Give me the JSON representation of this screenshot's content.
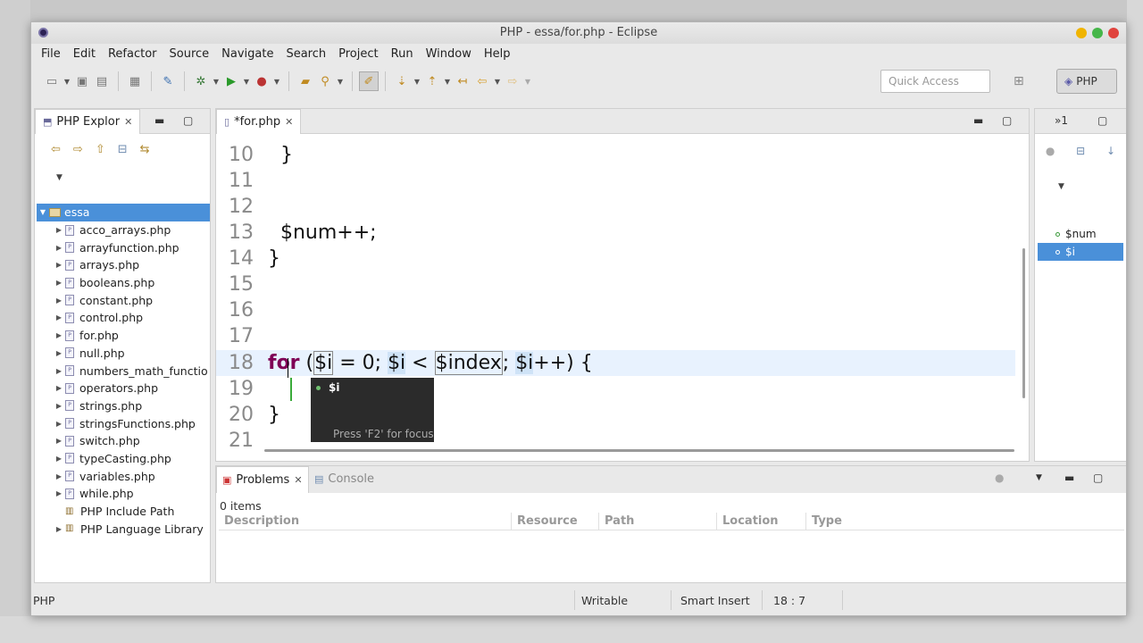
{
  "window": {
    "title": "PHP - essa/for.php - Eclipse"
  },
  "menu": [
    "File",
    "Edit",
    "Refactor",
    "Source",
    "Navigate",
    "Search",
    "Project",
    "Run",
    "Window",
    "Help"
  ],
  "toolbar": {
    "quick_access_placeholder": "Quick Access",
    "perspective_label": "PHP"
  },
  "explorer": {
    "tab_label": "PHP Explor",
    "project": "essa",
    "files": [
      "acco_arrays.php",
      "arrayfunction.php",
      "arrays.php",
      "booleans.php",
      "constant.php",
      "control.php",
      "for.php",
      "null.php",
      "numbers_math_functio",
      "operators.php",
      "strings.php",
      "stringsFunctions.php",
      "switch.php",
      "typeCasting.php",
      "variables.php",
      "while.php"
    ],
    "include_path": "PHP Include Path",
    "language_library": "PHP Language Library"
  },
  "editor": {
    "tab_label": "*for.php",
    "lines": [
      {
        "n": "10",
        "text": "  }"
      },
      {
        "n": "11",
        "text": ""
      },
      {
        "n": "12",
        "text": ""
      },
      {
        "n": "13",
        "text": "  $num++;"
      },
      {
        "n": "14",
        "text": "}"
      },
      {
        "n": "15",
        "text": ""
      },
      {
        "n": "16",
        "text": ""
      },
      {
        "n": "17",
        "text": ""
      },
      {
        "n": "18",
        "text": ""
      },
      {
        "n": "19",
        "text": ""
      },
      {
        "n": "20",
        "text": "}"
      },
      {
        "n": "21",
        "text": ""
      }
    ],
    "for_line": {
      "keyword": "for",
      "open": " (",
      "var": "$i",
      "after_var": " = 0; ",
      "var2": "$i",
      "mid": " < ",
      "index": "$index",
      "semi": "; ",
      "var3": "$i",
      "tail": "++) {"
    },
    "autocomplete": {
      "item": "$i",
      "hint": "Press 'F2' for focus"
    }
  },
  "outline": {
    "items": [
      "$num",
      "$i"
    ],
    "selected": "$i"
  },
  "problems": {
    "tab_problems": "Problems",
    "tab_console": "Console",
    "count": "0 items",
    "columns": [
      "Description",
      "Resource",
      "Path",
      "Location",
      "Type"
    ]
  },
  "status": {
    "context": "PHP",
    "writable": "Writable",
    "insert_mode": "Smart Insert",
    "position": "18 : 7"
  },
  "colors": {
    "keyword": "#7f0055",
    "selection": "#4a90d9",
    "current_line": "#e8f2fe"
  }
}
